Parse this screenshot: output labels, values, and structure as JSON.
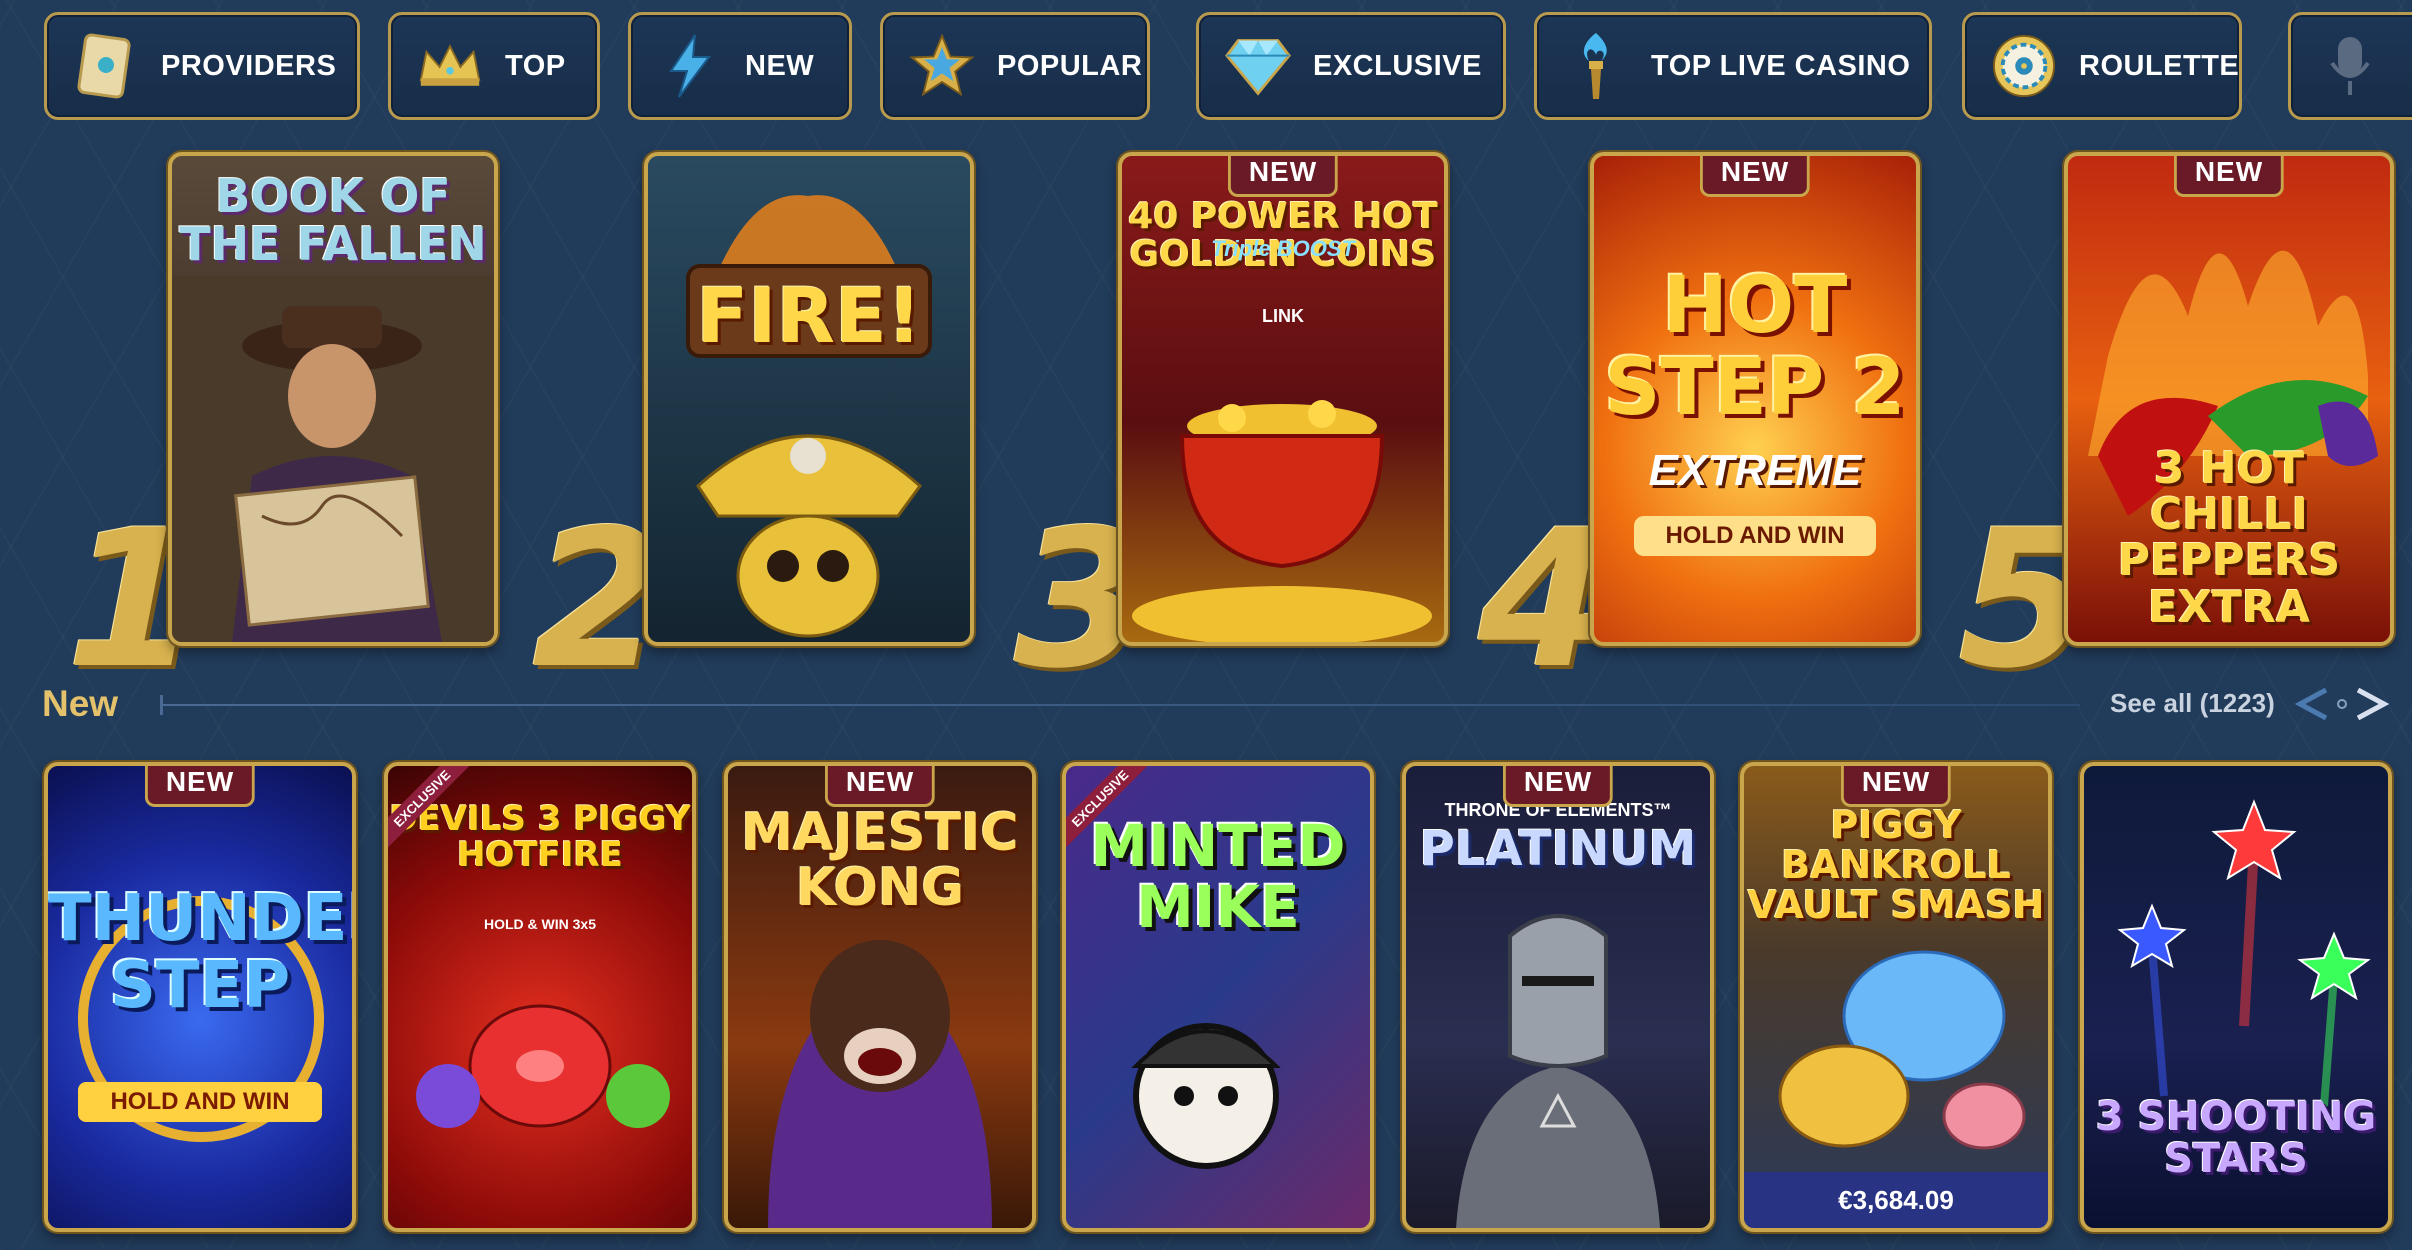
{
  "categories": [
    {
      "label": "PROVIDERS",
      "icon": "book-icon"
    },
    {
      "label": "TOP",
      "icon": "crown-icon"
    },
    {
      "label": "NEW",
      "icon": "lightning-icon"
    },
    {
      "label": "POPULAR",
      "icon": "star-icon"
    },
    {
      "label": "EXCLUSIVE",
      "icon": "diamond-icon"
    },
    {
      "label": "TOP LIVE CASINO",
      "icon": "torch-icon"
    },
    {
      "label": "ROULETTE",
      "icon": "roulette-icon"
    },
    {
      "label": "",
      "icon": "microphone-icon"
    }
  ],
  "top_games": [
    {
      "rank": "1",
      "title": "BOOK OF THE FALLEN",
      "badge": ""
    },
    {
      "rank": "2",
      "title": "FIRE!",
      "badge": ""
    },
    {
      "rank": "3",
      "title": "40 POWER HOT GOLDEN COINS",
      "subtitle": "Triple BOOST",
      "sub2": "LINK",
      "badge": "NEW"
    },
    {
      "rank": "4",
      "title": "HOT STEP 2",
      "subtitle": "EXTREME",
      "sub2": "HOLD AND WIN",
      "badge": "NEW"
    },
    {
      "rank": "5",
      "title": "3 HOT CHILLI PEPPERS EXTRA",
      "badge": "NEW"
    }
  ],
  "new_section": {
    "label": "New",
    "see_all": "See all (1223)",
    "games": [
      {
        "title": "THUNDER STEP",
        "subtitle": "HOLD AND WIN",
        "badge": "NEW",
        "exclusive": ""
      },
      {
        "title": "DEVILS 3 PIGGY HOTFIRE",
        "subtitle": "HOLD & WIN 3x5",
        "badge": "",
        "exclusive": "EXCLUSIVE"
      },
      {
        "title": "MAJESTIC KONG",
        "badge": "NEW",
        "exclusive": ""
      },
      {
        "title": "MINTED MIKE",
        "badge": "",
        "exclusive": "EXCLUSIVE"
      },
      {
        "title": "PLATINUM",
        "subtitle": "THRONE OF ELEMENTS™",
        "badge": "NEW",
        "exclusive": ""
      },
      {
        "title": "PIGGY BANKROLL VAULT SMASH",
        "badge": "NEW",
        "exclusive": "",
        "jackpot": "€3,684.09"
      },
      {
        "title": "3 SHOOTING STARS",
        "badge": "",
        "exclusive": ""
      }
    ]
  },
  "colors": {
    "background": "#213b5a",
    "gold": "#c9a54b",
    "badge": "#6a1a26"
  }
}
